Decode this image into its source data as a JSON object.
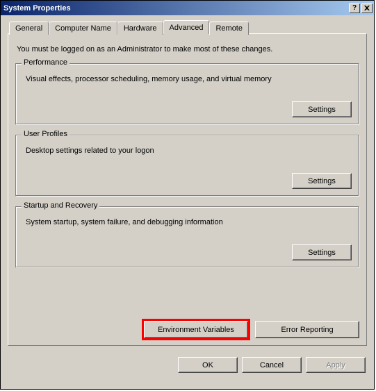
{
  "window": {
    "title": "System Properties"
  },
  "tabs": [
    "General",
    "Computer Name",
    "Hardware",
    "Advanced",
    "Remote"
  ],
  "active_tab": "Advanced",
  "intro": "You must be logged on as an Administrator to make most of these changes.",
  "groups": {
    "performance": {
      "legend": "Performance",
      "desc": "Visual effects, processor scheduling, memory usage, and virtual memory",
      "button": "Settings"
    },
    "profiles": {
      "legend": "User Profiles",
      "desc": "Desktop settings related to your logon",
      "button": "Settings"
    },
    "startup": {
      "legend": "Startup and Recovery",
      "desc": "System startup, system failure, and debugging information",
      "button": "Settings"
    }
  },
  "buttons": {
    "env": "Environment Variables",
    "error": "Error Reporting",
    "ok": "OK",
    "cancel": "Cancel",
    "apply": "Apply"
  }
}
